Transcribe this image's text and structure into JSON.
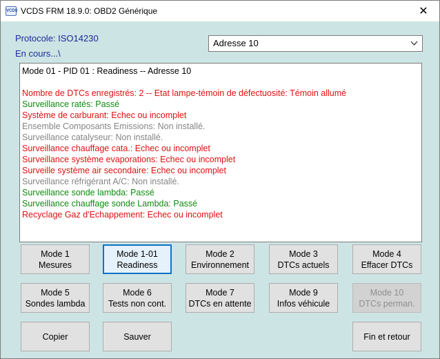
{
  "window": {
    "title": "VCDS FRM 18.9.0:  OBD2 Générique",
    "icon_text": "VCDS",
    "close_glyph": "✕"
  },
  "protocol": "Protocole: ISO14230",
  "status": "En cours...\\",
  "address_select": {
    "selected": "Adresse 10"
  },
  "output": {
    "header": "Mode 01 - PID 01 : Readiness  --  Adresse 10",
    "lines": [
      {
        "text": "Nombre de DTCs enregistrés: 2  --  Etat lampe-témoin de défectuosité: Témoin allumé",
        "color": "#e01010"
      },
      {
        "text": "Surveillance ratés:  Passé",
        "color": "#0f8a0f"
      },
      {
        "text": "Système de carburant:  Echec ou incomplet",
        "color": "#e01010"
      },
      {
        "text": "Ensemble Composants Emissions: Non installé.",
        "color": "#858585"
      },
      {
        "text": "Surveillance catalyseur: Non installé.",
        "color": "#858585"
      },
      {
        "text": "Surveillance chauffage cata.:  Echec ou incomplet",
        "color": "#e01010"
      },
      {
        "text": "Surveillance système evaporations:  Echec ou incomplet",
        "color": "#e01010"
      },
      {
        "text": "Surveille système air secondaire:  Echec ou incomplet",
        "color": "#e01010"
      },
      {
        "text": "Surveillance réfrigérant A/C: Non installé.",
        "color": "#858585"
      },
      {
        "text": "Surveillance sonde lambda:  Passé",
        "color": "#0f8a0f"
      },
      {
        "text": "Surveillance chauffage sonde Lambda:  Passé",
        "color": "#0f8a0f"
      },
      {
        "text": "Recyclage Gaz d'Echappement:  Echec ou incomplet",
        "color": "#e01010"
      }
    ]
  },
  "buttons": {
    "mode1": {
      "l1": "Mode 1",
      "l2": "Mesures"
    },
    "mode1_01": {
      "l1": "Mode 1-01",
      "l2": "Readiness"
    },
    "mode2": {
      "l1": "Mode 2",
      "l2": "Environnement"
    },
    "mode3": {
      "l1": "Mode 3",
      "l2": "DTCs actuels"
    },
    "mode4": {
      "l1": "Mode 4",
      "l2": "Effacer DTCs"
    },
    "mode5": {
      "l1": "Mode 5",
      "l2": "Sondes lambda"
    },
    "mode6": {
      "l1": "Mode 6",
      "l2": "Tests non cont."
    },
    "mode7": {
      "l1": "Mode 7",
      "l2": "DTCs en attente"
    },
    "mode9": {
      "l1": "Mode 9",
      "l2": "Infos véhicule"
    },
    "mode10": {
      "l1": "Mode 10",
      "l2": "DTCs perman."
    },
    "copy": "Copier",
    "save": "Sauver",
    "exit": "Fin et retour"
  },
  "colors": {
    "background": "#cde4e4",
    "focus": "#0a72c8",
    "text_blue": "#1a2a9e"
  }
}
